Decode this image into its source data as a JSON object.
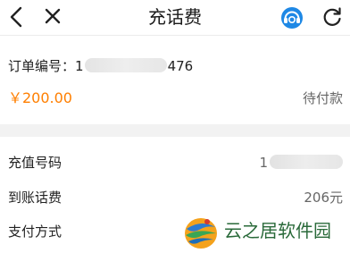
{
  "header": {
    "title": "充话费",
    "back_icon": "chevron-left-icon",
    "close_icon": "close-icon",
    "service_icon": "customer-service-icon",
    "refresh_icon": "refresh-icon"
  },
  "order": {
    "label": "订单编号：",
    "number_prefix": "1",
    "number_suffix": "476",
    "amount": "￥200.00",
    "status": "待付款"
  },
  "details": {
    "recharge_number_label": "充值号码",
    "recharge_number_prefix": "1",
    "credit_label": "到账话费",
    "credit_value": "206元",
    "payment_label": "支付方式"
  },
  "watermark": {
    "text": "云之居软件园"
  },
  "colors": {
    "accent": "#ff7f00",
    "service_blue": "#1e88e5",
    "divider": "#f2f2f2"
  }
}
